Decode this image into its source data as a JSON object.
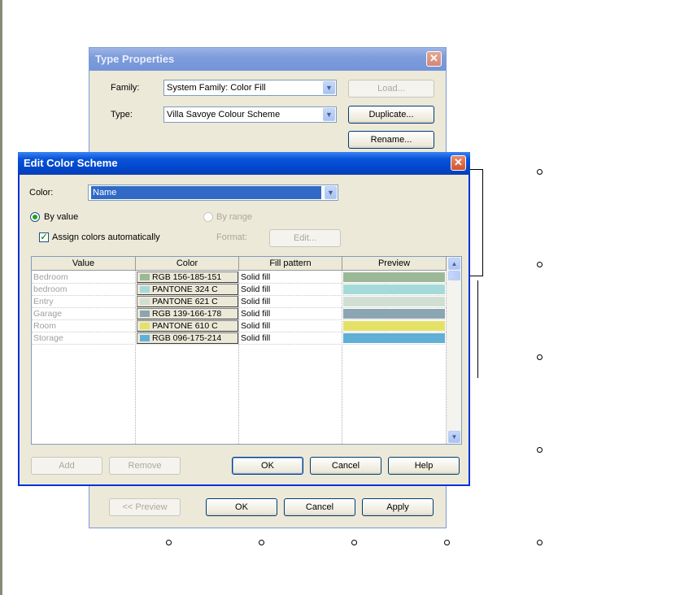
{
  "type_properties": {
    "title": "Type Properties",
    "family_label": "Family:",
    "family_value": "System Family: Color Fill",
    "type_label": "Type:",
    "type_value": "Villa Savoye Colour Scheme",
    "load_label": "Load...",
    "duplicate_label": "Duplicate...",
    "rename_label": "Rename...",
    "preview_label": "<< Preview",
    "ok_label": "OK",
    "cancel_label": "Cancel",
    "apply_label": "Apply"
  },
  "edit_color_scheme": {
    "title": "Edit Color Scheme",
    "color_label": "Color:",
    "color_value": "Name",
    "by_value_label": "By value",
    "by_range_label": "By range",
    "assign_auto_label": "Assign colors automatically",
    "format_label": "Format:",
    "edit_label": "Edit...",
    "columns": [
      "Value",
      "Color",
      "Fill pattern",
      "Preview"
    ],
    "rows": [
      {
        "value": "Bedroom",
        "color": "RGB 156-185-151",
        "swatch": "#9cb997",
        "fill": "Solid fill"
      },
      {
        "value": "bedroom",
        "color": "PANTONE 324 C",
        "swatch": "#a4dbd8",
        "fill": "Solid fill"
      },
      {
        "value": "Entry",
        "color": "PANTONE 621 C",
        "swatch": "#d1dfd3",
        "fill": "Solid fill"
      },
      {
        "value": "Garage",
        "color": "RGB 139-166-178",
        "swatch": "#8ba6b2",
        "fill": "Solid fill"
      },
      {
        "value": "Room",
        "color": "PANTONE 610 C",
        "swatch": "#e4e167",
        "fill": "Solid fill"
      },
      {
        "value": "Storage",
        "color": "RGB 096-175-214",
        "swatch": "#60afd6",
        "fill": "Solid fill"
      }
    ],
    "add_label": "Add",
    "remove_label": "Remove",
    "ok_label": "OK",
    "cancel_label": "Cancel",
    "help_label": "Help"
  },
  "icons": {
    "close": "close-icon",
    "dropdown": "chevron-down-icon",
    "scroll_up": "scroll-up-arrow-icon",
    "scroll_down": "scroll-down-arrow-icon"
  }
}
